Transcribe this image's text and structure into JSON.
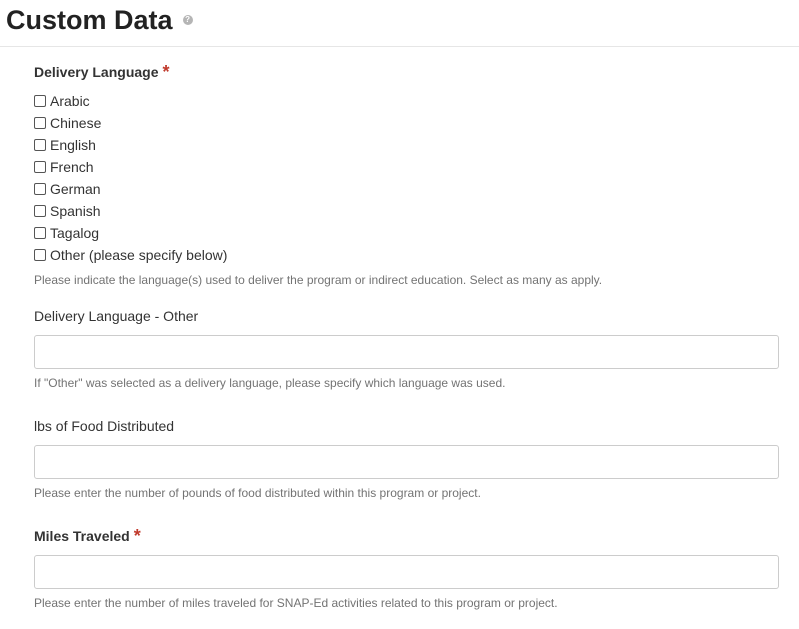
{
  "header": {
    "title": "Custom Data",
    "help_icon": "?"
  },
  "form": {
    "delivery_language": {
      "label": "Delivery Language",
      "required_mark": "*",
      "options": [
        "Arabic",
        "Chinese",
        "English",
        "French",
        "German",
        "Spanish",
        "Tagalog",
        "Other (please specify below)"
      ],
      "help": "Please indicate the language(s) used to deliver the program or indirect education. Select as many as apply."
    },
    "delivery_language_other": {
      "label": "Delivery Language - Other",
      "value": "",
      "help": "If \"Other\" was selected as a delivery language, please specify which language was used."
    },
    "lbs_food": {
      "label": "lbs of Food Distributed",
      "value": "",
      "help": "Please enter the number of pounds of food distributed within this program or project."
    },
    "miles_traveled": {
      "label": "Miles Traveled",
      "required_mark": "*",
      "value": "",
      "help": "Please enter the number of miles traveled for SNAP-Ed activities related to this program or project."
    }
  }
}
